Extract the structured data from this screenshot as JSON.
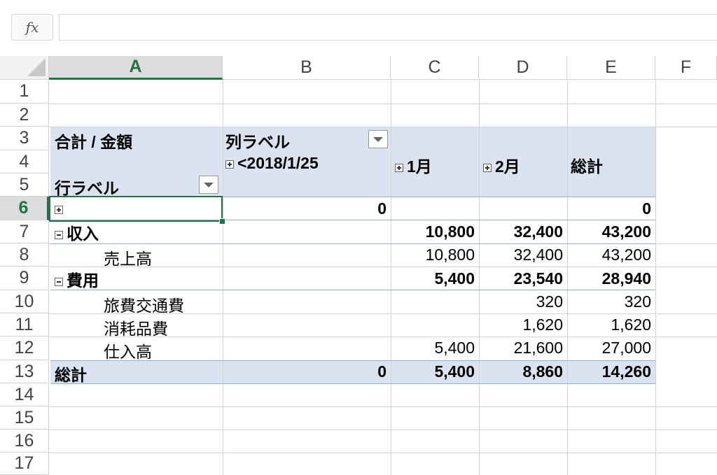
{
  "formula_bar": {
    "fx_label": "fx",
    "value": ""
  },
  "columns": [
    "A",
    "B",
    "C",
    "D",
    "E",
    "F"
  ],
  "selected_column": "A",
  "rows": [
    "1",
    "2",
    "3",
    "4",
    "5",
    "6",
    "7",
    "8",
    "9",
    "10",
    "11",
    "12",
    "13",
    "14",
    "15",
    "16",
    "17"
  ],
  "selected_row": "6",
  "pivot": {
    "value_field": "合計 / 金額",
    "col_label": "列ラベル",
    "row_label": "行ラベル",
    "col_items": [
      "<2018/1/25",
      "1月",
      "2月"
    ],
    "grand_total_header": "総計",
    "row6": {
      "label": "",
      "b": "0",
      "e": "0"
    },
    "income": {
      "label": "収入",
      "c": "10,800",
      "d": "32,400",
      "e": "43,200"
    },
    "sales": {
      "label": "売上高",
      "c": "10,800",
      "d": "32,400",
      "e": "43,200"
    },
    "expense": {
      "label": "費用",
      "c": "5,400",
      "d": "23,540",
      "e": "28,940"
    },
    "travel": {
      "label": "旅費交通費",
      "d": "320",
      "e": "320"
    },
    "supplies": {
      "label": "消耗品費",
      "d": "1,620",
      "e": "1,620"
    },
    "purchases": {
      "label": "仕入高",
      "c": "5,400",
      "d": "21,600",
      "e": "27,000"
    },
    "total": {
      "label": "総計",
      "b": "0",
      "c": "5,400",
      "d": "8,860",
      "e": "14,260"
    }
  },
  "colors": {
    "accent": "#217346",
    "pivot_band": "#dce3f0",
    "pivot_line": "#95b3d7"
  }
}
